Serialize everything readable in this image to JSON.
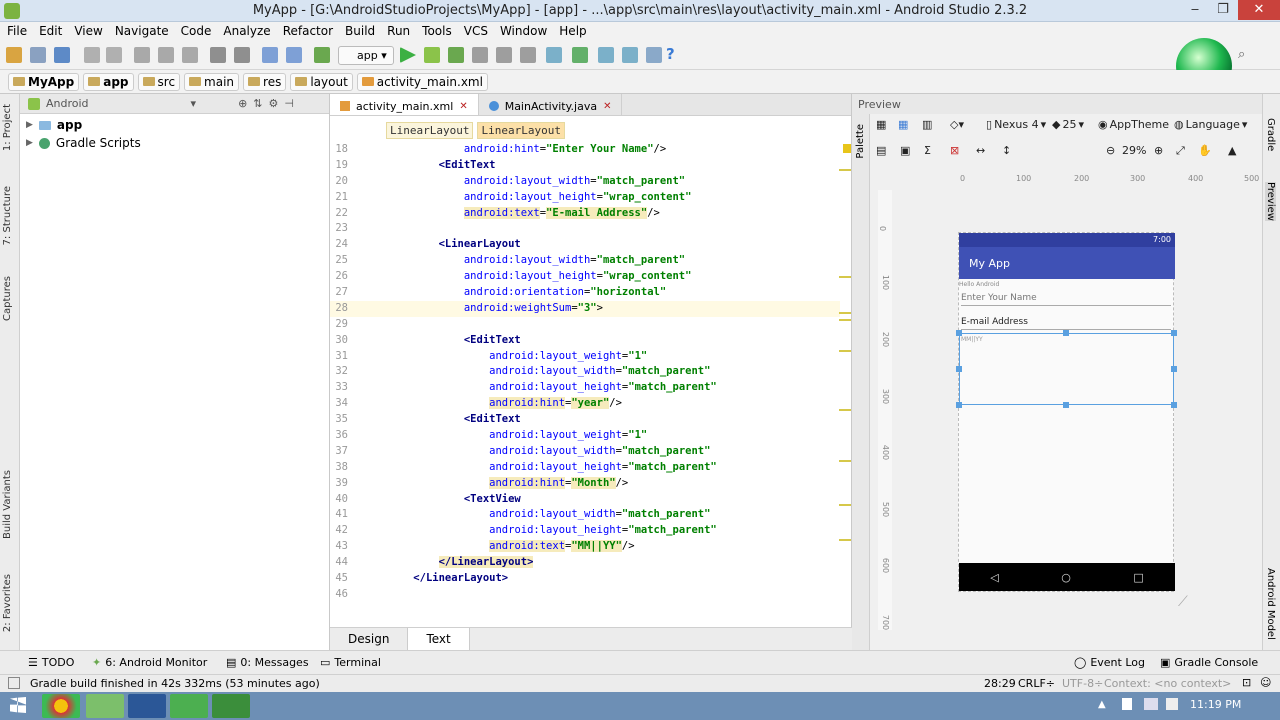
{
  "window": {
    "title": "MyApp - [G:\\AndroidStudioProjects\\MyApp] - [app] - ...\\app\\src\\main\\res\\layout\\activity_main.xml - Android Studio 2.3.2",
    "minimize": "‒",
    "maximize": "❐",
    "close": "✕"
  },
  "menu": [
    "File",
    "Edit",
    "View",
    "Navigate",
    "Code",
    "Analyze",
    "Refactor",
    "Build",
    "Run",
    "Tools",
    "VCS",
    "Window",
    "Help"
  ],
  "toolbar": {
    "run_config": "app",
    "help": "?"
  },
  "navbar": [
    "MyApp",
    "app",
    "src",
    "main",
    "res",
    "layout",
    "activity_main.xml"
  ],
  "project_panel": {
    "view_mode": "Android",
    "items": [
      "app",
      "Gradle Scripts"
    ]
  },
  "left_strip": {
    "project": "1: Project",
    "structure": "7: Structure",
    "captures": "Captures",
    "build_variants": "Build Variants",
    "favorites": "2: Favorites"
  },
  "editor": {
    "tabs": [
      {
        "label": "activity_main.xml",
        "active": true
      },
      {
        "label": "MainActivity.java",
        "active": false
      }
    ],
    "breadcrumbs": [
      "LinearLayout",
      "LinearLayout"
    ],
    "bottom_tabs": [
      "Design",
      "Text"
    ],
    "lines": [
      {
        "n": "18",
        "indent": "            ",
        "parts": [
          {
            "c": "aname",
            "t": "android:hint"
          },
          {
            "c": "",
            "t": "="
          },
          {
            "c": "val",
            "t": "\"Enter Your Name\""
          },
          {
            "c": "",
            "t": "/>"
          }
        ]
      },
      {
        "n": "19",
        "indent": "        ",
        "parts": [
          {
            "c": "tag",
            "t": "<EditText"
          }
        ]
      },
      {
        "n": "20",
        "indent": "            ",
        "parts": [
          {
            "c": "aname",
            "t": "android:layout_width"
          },
          {
            "c": "",
            "t": "="
          },
          {
            "c": "val",
            "t": "\"match_parent\""
          }
        ]
      },
      {
        "n": "21",
        "indent": "            ",
        "parts": [
          {
            "c": "aname",
            "t": "android:layout_height"
          },
          {
            "c": "",
            "t": "="
          },
          {
            "c": "val",
            "t": "\"wrap_content\""
          }
        ]
      },
      {
        "n": "22",
        "indent": "            ",
        "parts": [
          {
            "c": "aname hl",
            "t": "android:text"
          },
          {
            "c": "",
            "t": "="
          },
          {
            "c": "val hl",
            "t": "\"E-mail Address\""
          },
          {
            "c": "",
            "t": "/>"
          }
        ]
      },
      {
        "n": "23",
        "indent": "",
        "parts": []
      },
      {
        "n": "24",
        "indent": "        ",
        "parts": [
          {
            "c": "tag",
            "t": "<LinearLayout"
          }
        ]
      },
      {
        "n": "25",
        "indent": "            ",
        "parts": [
          {
            "c": "aname",
            "t": "android:layout_width"
          },
          {
            "c": "",
            "t": "="
          },
          {
            "c": "val",
            "t": "\"match_parent\""
          }
        ]
      },
      {
        "n": "26",
        "indent": "            ",
        "parts": [
          {
            "c": "aname",
            "t": "android:layout_height"
          },
          {
            "c": "",
            "t": "="
          },
          {
            "c": "val",
            "t": "\"wrap_content\""
          }
        ]
      },
      {
        "n": "27",
        "indent": "            ",
        "parts": [
          {
            "c": "aname",
            "t": "android:orientation"
          },
          {
            "c": "",
            "t": "="
          },
          {
            "c": "val",
            "t": "\"horizontal\""
          }
        ]
      },
      {
        "n": "28",
        "indent": "            ",
        "parts": [
          {
            "c": "aname",
            "t": "android:weightSum"
          },
          {
            "c": "",
            "t": "="
          },
          {
            "c": "val",
            "t": "\"3\""
          },
          {
            "c": "",
            "t": ">"
          }
        ],
        "current": true
      },
      {
        "n": "29",
        "indent": "",
        "parts": []
      },
      {
        "n": "30",
        "indent": "            ",
        "parts": [
          {
            "c": "tag",
            "t": "<EditText"
          }
        ]
      },
      {
        "n": "31",
        "indent": "                ",
        "parts": [
          {
            "c": "aname",
            "t": "android:layout_weight"
          },
          {
            "c": "",
            "t": "="
          },
          {
            "c": "val",
            "t": "\"1\""
          }
        ]
      },
      {
        "n": "32",
        "indent": "                ",
        "parts": [
          {
            "c": "aname",
            "t": "android:layout_width"
          },
          {
            "c": "",
            "t": "="
          },
          {
            "c": "val",
            "t": "\"match_parent\""
          }
        ]
      },
      {
        "n": "33",
        "indent": "                ",
        "parts": [
          {
            "c": "aname",
            "t": "android:layout_height"
          },
          {
            "c": "",
            "t": "="
          },
          {
            "c": "val",
            "t": "\"match_parent\""
          }
        ]
      },
      {
        "n": "34",
        "indent": "                ",
        "parts": [
          {
            "c": "aname hl",
            "t": "android:hint"
          },
          {
            "c": "",
            "t": "="
          },
          {
            "c": "val hl",
            "t": "\"year\""
          },
          {
            "c": "",
            "t": "/>"
          }
        ]
      },
      {
        "n": "35",
        "indent": "            ",
        "parts": [
          {
            "c": "tag",
            "t": "<EditText"
          }
        ]
      },
      {
        "n": "36",
        "indent": "                ",
        "parts": [
          {
            "c": "aname",
            "t": "android:layout_weight"
          },
          {
            "c": "",
            "t": "="
          },
          {
            "c": "val",
            "t": "\"1\""
          }
        ]
      },
      {
        "n": "37",
        "indent": "                ",
        "parts": [
          {
            "c": "aname",
            "t": "android:layout_width"
          },
          {
            "c": "",
            "t": "="
          },
          {
            "c": "val",
            "t": "\"match_parent\""
          }
        ]
      },
      {
        "n": "38",
        "indent": "                ",
        "parts": [
          {
            "c": "aname",
            "t": "android:layout_height"
          },
          {
            "c": "",
            "t": "="
          },
          {
            "c": "val",
            "t": "\"match_parent\""
          }
        ]
      },
      {
        "n": "39",
        "indent": "                ",
        "parts": [
          {
            "c": "aname hl",
            "t": "android:hint"
          },
          {
            "c": "",
            "t": "="
          },
          {
            "c": "val hl",
            "t": "\"Month\""
          },
          {
            "c": "",
            "t": "/>"
          }
        ]
      },
      {
        "n": "40",
        "indent": "            ",
        "parts": [
          {
            "c": "tag",
            "t": "<TextView"
          }
        ]
      },
      {
        "n": "41",
        "indent": "                ",
        "parts": [
          {
            "c": "aname",
            "t": "android:layout_width"
          },
          {
            "c": "",
            "t": "="
          },
          {
            "c": "val",
            "t": "\"match_parent\""
          }
        ]
      },
      {
        "n": "42",
        "indent": "                ",
        "parts": [
          {
            "c": "aname",
            "t": "android:layout_height"
          },
          {
            "c": "",
            "t": "="
          },
          {
            "c": "val",
            "t": "\"match_parent\""
          }
        ]
      },
      {
        "n": "43",
        "indent": "                ",
        "parts": [
          {
            "c": "aname hl",
            "t": "android:text"
          },
          {
            "c": "",
            "t": "="
          },
          {
            "c": "val hl",
            "t": "\"MM||YY\""
          },
          {
            "c": "",
            "t": "/>"
          }
        ]
      },
      {
        "n": "44",
        "indent": "        ",
        "parts": [
          {
            "c": "tag hl",
            "t": "</LinearLayout>"
          }
        ]
      },
      {
        "n": "45",
        "indent": "    ",
        "parts": [
          {
            "c": "tag",
            "t": "</LinearLayout>"
          }
        ]
      },
      {
        "n": "46",
        "indent": "",
        "parts": []
      }
    ]
  },
  "preview": {
    "title": "Preview",
    "device": "Nexus 4",
    "api": "25",
    "theme": "AppTheme",
    "language": "Language",
    "zoom": "29%",
    "ruler_h": [
      "0",
      "100",
      "200",
      "300",
      "400",
      "500"
    ],
    "ruler_v": [
      "0",
      "100",
      "200",
      "300",
      "400",
      "500",
      "600",
      "700"
    ],
    "phone": {
      "time": "7:00",
      "app_title": "My App",
      "hello": "Hello Android",
      "name_hint": "Enter Your Name",
      "email": "E-mail Address",
      "mmyy": "MM||YY"
    }
  },
  "right_strip": {
    "gradle": "Gradle",
    "preview": "Preview",
    "android_model": "Android Model"
  },
  "tool_windows": {
    "todo": "TODO",
    "android_monitor": "6: Android Monitor",
    "messages": "0: Messages",
    "terminal": "Terminal",
    "event_log": "Event Log",
    "gradle_console": "Gradle Console"
  },
  "status": {
    "message": "Gradle build finished in 42s 332ms (53 minutes ago)",
    "position": "28:29",
    "line_sep": "CRLF÷",
    "encoding": "UTF-8÷",
    "context": "Context: <no context>"
  },
  "taskbar": {
    "time": "11:19 PM"
  },
  "colors": {
    "appbar": "#3f51b5",
    "statusbar": "#303f9f",
    "tag": "#000080",
    "value": "#008000"
  }
}
